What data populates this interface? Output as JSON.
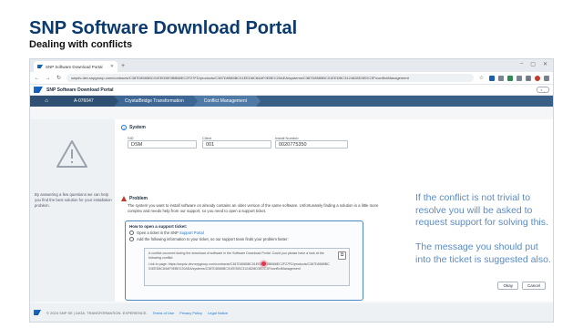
{
  "slide": {
    "title": "SNP Software Download Portal",
    "subtitle": "Dealing with conflicts"
  },
  "browser": {
    "tab_title": "SNP Software Download Portal",
    "url": "swpdv-dev.snpgroup.com/contracts/C387D8585BC01EEDBE0BB68EC2F27FD/products/C387D8585BC01EED8C84AF0EBEC20AEA/systems/C387D8585BC01EEDBC3124828D3EDC3F/conflictManagement",
    "icons": [
      "back-icon",
      "forward-icon",
      "reload-icon",
      "star-icon",
      "download-icon",
      "profile-icon",
      "menu-icon"
    ]
  },
  "shell": {
    "title": "SNP Software Download Portal"
  },
  "breadcrumb": {
    "items": [
      "A-076047",
      "CrystalBridge Transformation",
      "Conflict Management"
    ]
  },
  "left_panel": {
    "text": "By answering a few questions we can help you find the best solution for your installation problem."
  },
  "system": {
    "heading": "System",
    "sid_label": "SID",
    "sid_value": "DSM",
    "client_label": "Client",
    "client_value": "001",
    "install_label": "Install Number",
    "install_value": "0020775350"
  },
  "problem": {
    "heading": "Problem",
    "text": "The system you want to install software on already contains an older version of the same software. Unfortunately finding a solution is a little more complex and needs help from our support, so you need to open a support ticket."
  },
  "support": {
    "title": "How to open a support ticket:",
    "opt1_prefix": "Open a ticket in the SNP",
    "opt1_link": "Support Portal",
    "opt2": "Add the following information to your ticket, so our support team finds your problem faster:",
    "message": "A conflict occurred during the download of software in the Software Download Portal. Could you please have a look at the following conflict:",
    "link_prefix": "Link to page:",
    "link": "https://swpdv-dev.snpgroup.com/contracts/C387D8585BC01EEDBE0BB68EC2F27FD/products/C387D8585BC01EED8C84AF0EBEC20AEA/systems/C387D8585BC01EEDBC3124828D3EDC3F/conflictManagement"
  },
  "buttons": {
    "okay": "Okay",
    "cancel": "Cancel"
  },
  "notes": {
    "note1": "If the conflict is not trivial to resolve you will be asked to request support for solving this.",
    "note2": "The message you should put into the ticket is suggested also."
  },
  "footer": {
    "copyright": "© 2024 SNP SE | DATA. TRANSFORMATION. EXPERIENCE.",
    "terms": "Terms of Use",
    "privacy": "Privacy Policy",
    "legal": "Legal Notice"
  },
  "colors": {
    "title": "#0b3a6e",
    "note": "#5a8bc4",
    "accent": "#1873d3",
    "warning": "#c0392b"
  }
}
